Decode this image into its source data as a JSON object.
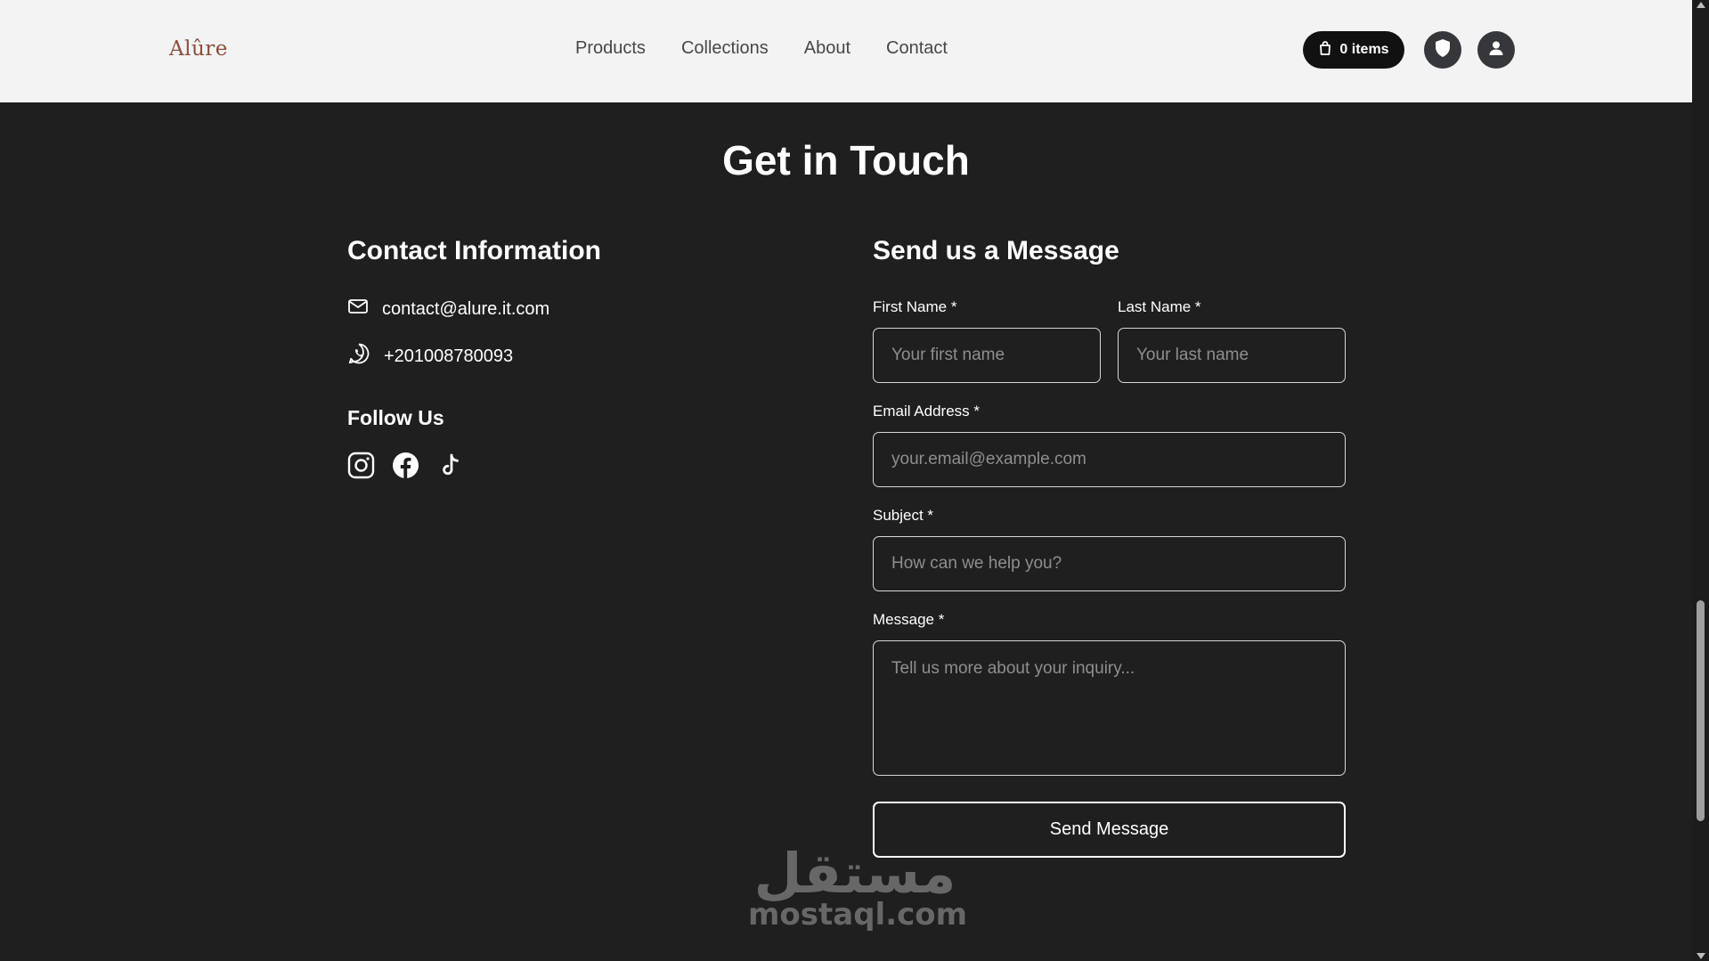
{
  "header": {
    "logo": "Alûre",
    "nav": [
      "Products",
      "Collections",
      "About",
      "Contact"
    ],
    "cart_label": "0 items"
  },
  "page": {
    "title": "Get in Touch"
  },
  "contact": {
    "title": "Contact Information",
    "email": "contact@alure.it.com",
    "phone": "+201008780093",
    "follow_title": "Follow Us",
    "socials": [
      "instagram-icon",
      "facebook-icon",
      "tiktok-icon"
    ]
  },
  "form": {
    "title": "Send us a Message",
    "first_name": {
      "label": "First Name *",
      "placeholder": "Your first name",
      "value": ""
    },
    "last_name": {
      "label": "Last Name *",
      "placeholder": "Your last name",
      "value": ""
    },
    "email": {
      "label": "Email Address *",
      "placeholder": "your.email@example.com",
      "value": ""
    },
    "subject": {
      "label": "Subject *",
      "placeholder": "How can we help you?",
      "value": ""
    },
    "message": {
      "label": "Message *",
      "placeholder": "Tell us more about your inquiry...",
      "value": ""
    },
    "submit_label": "Send Message"
  },
  "watermark": {
    "arabic": "مستقل",
    "latin": "mostaql.com"
  },
  "colors": {
    "header_bg": "#f3f3f3",
    "page_bg": "#1f1f1f",
    "logo": "#8a4f3e",
    "cart_bg": "#111111"
  }
}
